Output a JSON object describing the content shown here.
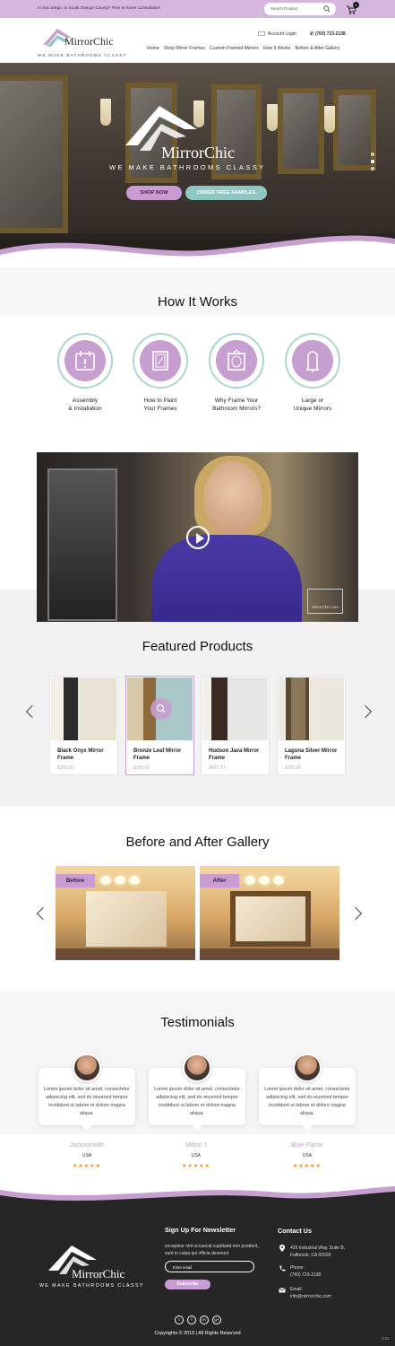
{
  "topbar": {
    "promo": "In San Diego, or South Orange County? Free In-home Consultation",
    "search_placeholder": "Search Product",
    "cart_count": "0"
  },
  "header": {
    "logo_name": "MirrorChic",
    "logo_tagline": "WE MAKE BATHROOMS CLASSY",
    "account_login": "Account Login",
    "phone": "(760) 723-2138",
    "nav": [
      "Home",
      "Shop Mirror Frames",
      "Custom Framed Mirrors",
      "How It Works",
      "Before & After Gallery"
    ]
  },
  "hero": {
    "logo_name": "MirrorChic",
    "tagline": "WE MAKE BATHROOMS CLASSY",
    "btn_shop": "SHOP NOW",
    "btn_samples": "ORDER FREE SAMPLES"
  },
  "how_it_works": {
    "title": "How It Works",
    "items": [
      {
        "line1": "Assembly",
        "line2": "& Installation",
        "icon": "calendar-icon"
      },
      {
        "line1": "How to Paint",
        "line2": "Your Frames",
        "icon": "frame-icon"
      },
      {
        "line1": "Why Frame Your",
        "line2": "Bathroom Mirrors?",
        "icon": "mirror-icon"
      },
      {
        "line1": "Large or",
        "line2": "Unique Mirrors",
        "icon": "standing-mirror-icon"
      }
    ]
  },
  "video": {
    "watermark": "MirrorChic.com"
  },
  "featured": {
    "title": "Featured Products",
    "products": [
      {
        "name": "Black Onyx Mirror Frame",
        "price": "$399.00"
      },
      {
        "name": "Bronze Leaf Mirror Frame",
        "price": "$399.00"
      },
      {
        "name": "Hudson Java Mirror Frame",
        "price": "$409.70"
      },
      {
        "name": "Laguna Silver Mirror Frame",
        "price": "$105.30"
      }
    ]
  },
  "gallery": {
    "title": "Before and After Gallery",
    "before": "Before",
    "after": "After"
  },
  "testimonials": {
    "title": "Testimonials",
    "items": [
      {
        "text": "Lorem ipsum dolor sit amet, consectetur adipiscing elit, sed do eiusmod tempor incididunt ut labore et dolore magna aliqua.",
        "name": "Jacksonville",
        "location": "USA",
        "stars": "★★★★★"
      },
      {
        "text": "Lorem ipsum dolor sit amet, consectetur adipiscing elit, sed do eiusmod tempor incididunt ut labore et dolore magna aliqua.",
        "name": "Milton J",
        "location": "USA",
        "stars": "★★★★★"
      },
      {
        "text": "Lorem ipsum dolor sit amet, consectetur adipiscing elit, sed do eiusmod tempor incididunt ut labore et dolore magna aliqua.",
        "name": "Blue Flame",
        "location": "USA",
        "stars": "★★★★★"
      }
    ]
  },
  "footer": {
    "logo_name": "MirrorChic",
    "logo_tagline": "WE MAKE BATHROOMS CLASSY",
    "newsletter_title": "Sign Up For Newsletter",
    "newsletter_text": "excepteur sint occaecat cupidatat non proident, sunt in culpa qui officia deserunt",
    "email_placeholder": "Enter email",
    "subscribe": "Subscribe",
    "contact_title": "Contact Us",
    "address1": "429 Industrial Way, Suite B,",
    "address2": "Fallbrook, CA 92028",
    "phone_label": "Phone:",
    "phone": "(760) 723-2138",
    "email_label": "Email:",
    "email": "info@mirrorchic.com",
    "social": [
      "t",
      "f",
      "in",
      "g+"
    ],
    "copyright": "Copyrights © 2019 | All Rights Reserved",
    "corner": "CS1"
  },
  "colors": {
    "accent": "#c79ed0",
    "teal": "#8ec7c2",
    "footer_bg": "#262626",
    "star": "#f08a24"
  }
}
